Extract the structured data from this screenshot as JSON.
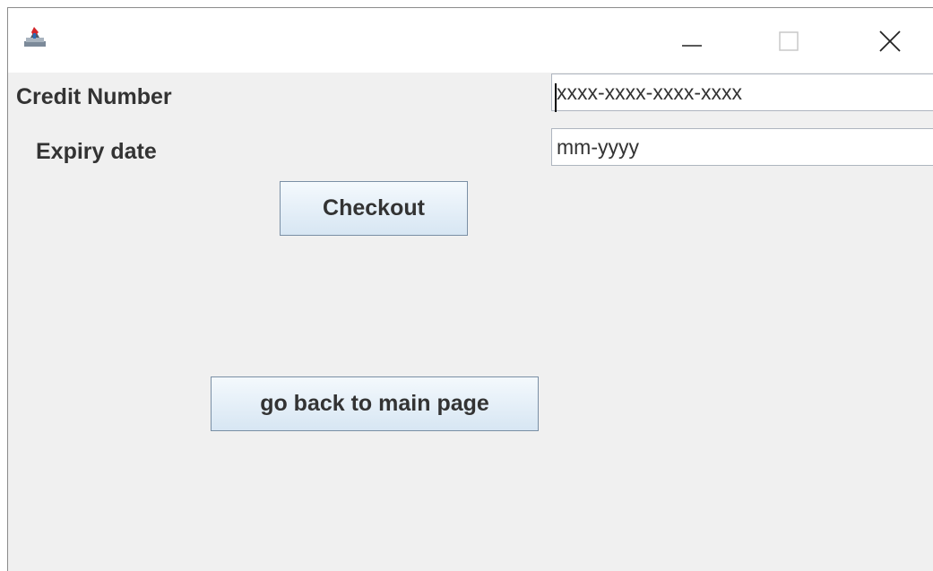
{
  "window": {
    "icons": {
      "app": "java-app-icon",
      "minimize": "minimize-icon",
      "maximize": "maximize-icon",
      "close": "close-icon"
    }
  },
  "form": {
    "credit_number_label": "Credit Number",
    "credit_number_placeholder": "xxxx-xxxx-xxxx-xxxx",
    "expiry_label": "Expiry date",
    "expiry_placeholder": "mm-yyyy"
  },
  "buttons": {
    "checkout": "Checkout",
    "back": "go back to main page"
  },
  "colors": {
    "background": "#f0f0f0",
    "button_top": "#f4f9fd",
    "button_bottom": "#d7e6f3",
    "button_border": "#7a8fa5",
    "text": "#333333"
  }
}
